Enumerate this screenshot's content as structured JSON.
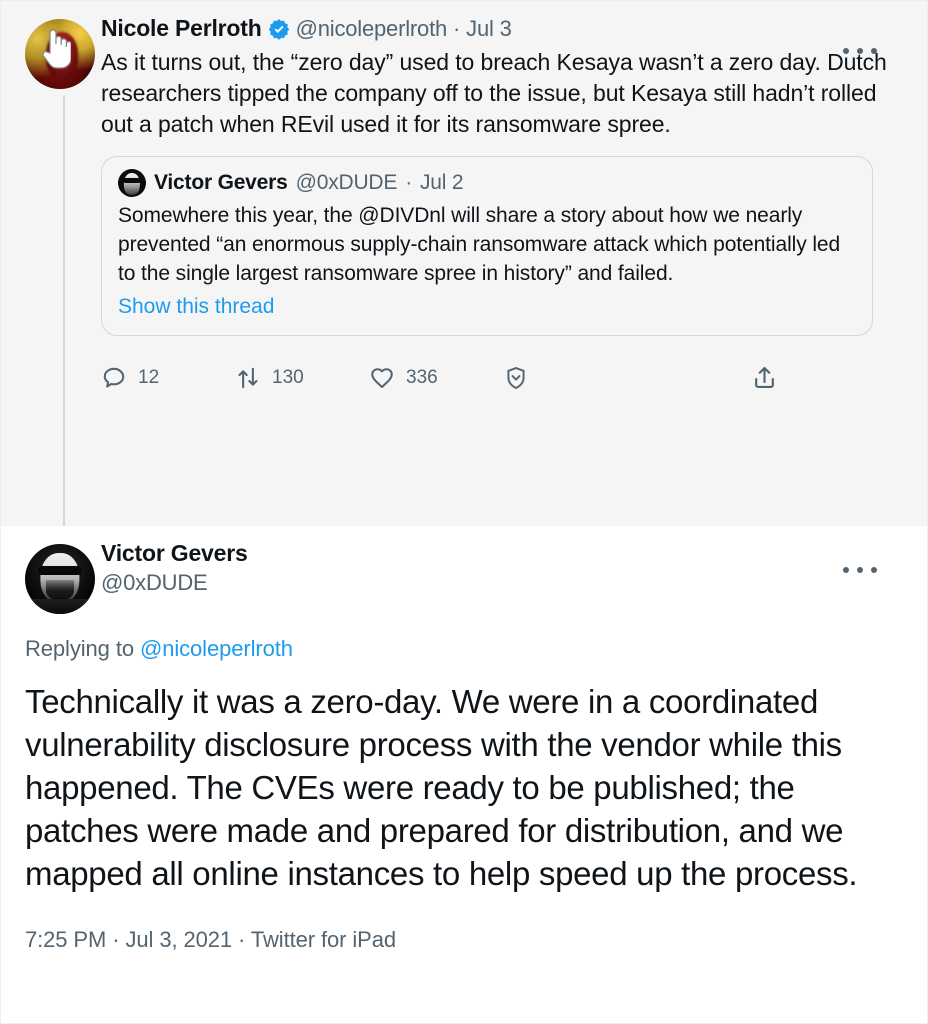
{
  "theme": {
    "accent": "#1d9bf0",
    "text_primary": "#0f1419",
    "text_secondary": "#536471",
    "border": "#cfd9de",
    "parent_bg": "#f5f5f5",
    "main_bg": "#ffffff"
  },
  "parent_tweet": {
    "display_name": "Nicole Perlroth",
    "verified_icon": "verified-badge-icon",
    "handle": "@nicoleperlroth",
    "separator": "·",
    "date": "Jul 3",
    "avatar_icon": "avatar-nicole-perlroth",
    "cursor_icon": "hand-cursor-icon",
    "more_icon": "more-options-icon",
    "body": "As it turns out, the “zero day” used to breach Kesaya wasn’t a zero day. Dutch researchers tipped the company off to the issue, but Kesaya still hadn’t rolled out a patch when REvil used it for its ransomware spree.",
    "quote": {
      "display_name": "Victor Gevers",
      "handle": "@0xDUDE",
      "separator": "·",
      "date": "Jul 2",
      "avatar_icon": "avatar-victor-gevers-small",
      "body": "Somewhere this year, the @DIVDnl will share a story about how we nearly prevented “an enormous supply-chain ransomware attack which potentially led to the single largest ransomware spree in history” and failed.",
      "show_thread_label": "Show this thread"
    },
    "actions": [
      {
        "name": "reply",
        "icon": "reply-icon",
        "count": "12"
      },
      {
        "name": "retweet",
        "icon": "retweet-icon",
        "count": "130"
      },
      {
        "name": "like",
        "icon": "heart-icon",
        "count": "336"
      },
      {
        "name": "view-activity",
        "icon": "shield-chevron-icon",
        "count": ""
      },
      {
        "name": "share",
        "icon": "share-upload-icon",
        "count": ""
      }
    ]
  },
  "main_tweet": {
    "display_name": "Victor Gevers",
    "handle": "@0xDUDE",
    "avatar_icon": "avatar-victor-gevers",
    "more_icon": "more-options-icon",
    "replying_prefix": "Replying to ",
    "replying_mention": "@nicoleperlroth",
    "body": "Technically it was a zero-day. We were in a coordinated vulnerability disclosure process with the vendor while this happened. The CVEs were ready to be published; the patches were made and prepared for distribution, and we mapped all online instances to help speed up the process.",
    "timestamp": "7:25 PM · Jul 3, 2021 · Twitter for iPad"
  }
}
